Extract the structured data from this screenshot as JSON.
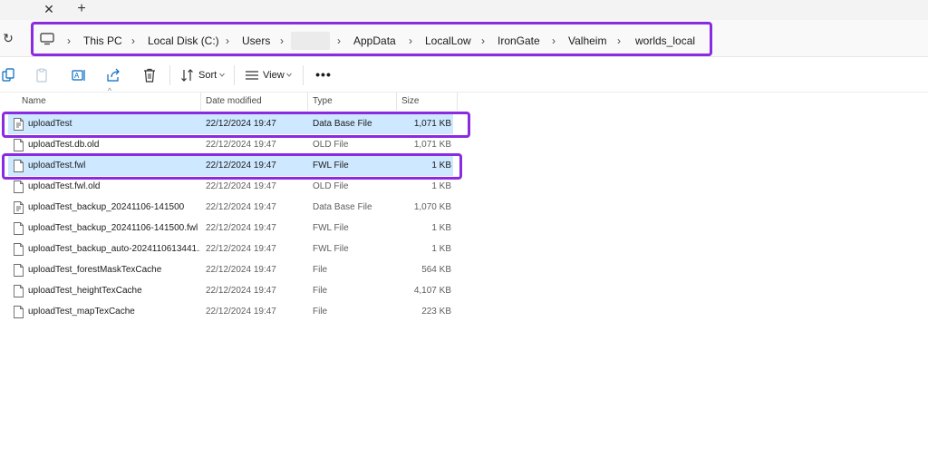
{
  "tabs": {
    "close_glyph": "✕",
    "new_tab_glyph": "+"
  },
  "address": {
    "refresh_glyph": "↻",
    "crumbs": [
      "This PC",
      "Local Disk (C:)",
      "Users",
      "AppData",
      "LocalLow",
      "IronGate",
      "Valheim",
      "worlds_local"
    ],
    "separator": "›"
  },
  "commands": {
    "sort_label": "Sort",
    "view_label": "View",
    "more_label": "•••"
  },
  "columns": {
    "name": "Name",
    "date": "Date modified",
    "type": "Type",
    "size": "Size"
  },
  "files": [
    {
      "name": "uploadTest",
      "date": "22/12/2024 19:47",
      "type": "Data Base File",
      "size": "1,071 KB",
      "icon": "database-file-icon",
      "selected": true
    },
    {
      "name": "uploadTest.db.old",
      "date": "22/12/2024 19:47",
      "type": "OLD File",
      "size": "1,071 KB",
      "icon": "file-icon",
      "selected": false
    },
    {
      "name": "uploadTest.fwl",
      "date": "22/12/2024 19:47",
      "type": "FWL File",
      "size": "1 KB",
      "icon": "file-icon",
      "selected": true
    },
    {
      "name": "uploadTest.fwl.old",
      "date": "22/12/2024 19:47",
      "type": "OLD File",
      "size": "1 KB",
      "icon": "file-icon",
      "selected": false
    },
    {
      "name": "uploadTest_backup_20241106-141500",
      "date": "22/12/2024 19:47",
      "type": "Data Base File",
      "size": "1,070 KB",
      "icon": "database-file-icon",
      "selected": false
    },
    {
      "name": "uploadTest_backup_20241106-141500.fwl",
      "date": "22/12/2024 19:47",
      "type": "FWL File",
      "size": "1 KB",
      "icon": "file-icon",
      "selected": false
    },
    {
      "name": "uploadTest_backup_auto-2024110613441...",
      "date": "22/12/2024 19:47",
      "type": "FWL File",
      "size": "1 KB",
      "icon": "file-icon",
      "selected": false
    },
    {
      "name": "uploadTest_forestMaskTexCache",
      "date": "22/12/2024 19:47",
      "type": "File",
      "size": "564 KB",
      "icon": "file-icon",
      "selected": false
    },
    {
      "name": "uploadTest_heightTexCache",
      "date": "22/12/2024 19:47",
      "type": "File",
      "size": "4,107 KB",
      "icon": "file-icon",
      "selected": false
    },
    {
      "name": "uploadTest_mapTexCache",
      "date": "22/12/2024 19:47",
      "type": "File",
      "size": "223 KB",
      "icon": "file-icon",
      "selected": false
    }
  ],
  "colors": {
    "highlight": "#8a2be2",
    "selection": "#cde8ff",
    "accent": "#0067c0"
  }
}
